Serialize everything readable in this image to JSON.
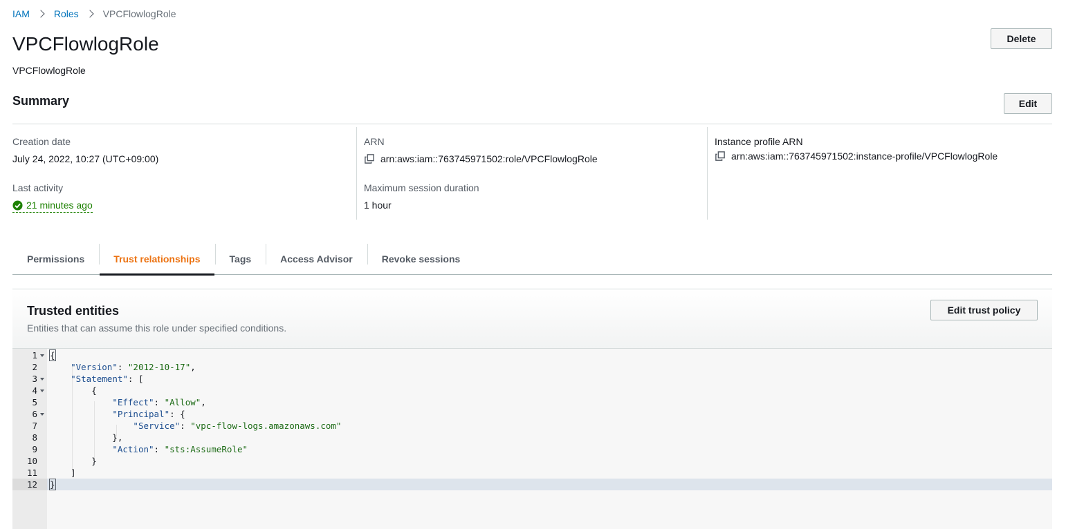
{
  "breadcrumb": {
    "items": [
      {
        "label": "IAM"
      },
      {
        "label": "Roles"
      },
      {
        "label": "VPCFlowlogRole"
      }
    ]
  },
  "page": {
    "title": "VPCFlowlogRole",
    "subtitle": "VPCFlowlogRole",
    "delete_label": "Delete"
  },
  "summary": {
    "title": "Summary",
    "edit_label": "Edit",
    "creation_date_label": "Creation date",
    "creation_date_value": "July 24, 2022, 10:27 (UTC+09:00)",
    "last_activity_label": "Last activity",
    "last_activity_value": "21 minutes ago",
    "arn_label": "ARN",
    "arn_value": "arn:aws:iam::763745971502:role/VPCFlowlogRole",
    "max_session_label": "Maximum session duration",
    "max_session_value": "1 hour",
    "instance_profile_label": "Instance profile ARN",
    "instance_profile_value": "arn:aws:iam::763745971502:instance-profile/VPCFlowlogRole"
  },
  "tabs": [
    {
      "label": "Permissions",
      "active": false
    },
    {
      "label": "Trust relationships",
      "active": true
    },
    {
      "label": "Tags",
      "active": false
    },
    {
      "label": "Access Advisor",
      "active": false
    },
    {
      "label": "Revoke sessions",
      "active": false
    }
  ],
  "trusted_entities": {
    "title": "Trusted entities",
    "description": "Entities that can assume this role under specified conditions.",
    "edit_label": "Edit trust policy"
  },
  "editor": {
    "lines": [
      {
        "number": "1",
        "text": "{"
      },
      {
        "number": "2",
        "text": "    \"Version\": \"2012-10-17\","
      },
      {
        "number": "3",
        "text": "    \"Statement\": ["
      },
      {
        "number": "4",
        "text": "        {"
      },
      {
        "number": "5",
        "text": "            \"Effect\": \"Allow\","
      },
      {
        "number": "6",
        "text": "            \"Principal\": {"
      },
      {
        "number": "7",
        "text": "                \"Service\": \"vpc-flow-logs.amazonaws.com\""
      },
      {
        "number": "8",
        "text": "            },"
      },
      {
        "number": "9",
        "text": "            \"Action\": \"sts:AssumeRole\""
      },
      {
        "number": "10",
        "text": "        }"
      },
      {
        "number": "11",
        "text": "    ]"
      },
      {
        "number": "12",
        "text": "}"
      }
    ],
    "foldable_lines": [
      "1",
      "3",
      "4",
      "6"
    ],
    "active_line": "12"
  },
  "colors": {
    "link": "#0073bb",
    "active_tab": "#ec7211",
    "success": "#1d8102",
    "json_key": "#1d4e8f",
    "json_string": "#1d6b16"
  },
  "icons": {
    "copy": "copy-icon",
    "status": "success-check-icon",
    "breadcrumb_separator": "chevron-right-icon"
  }
}
